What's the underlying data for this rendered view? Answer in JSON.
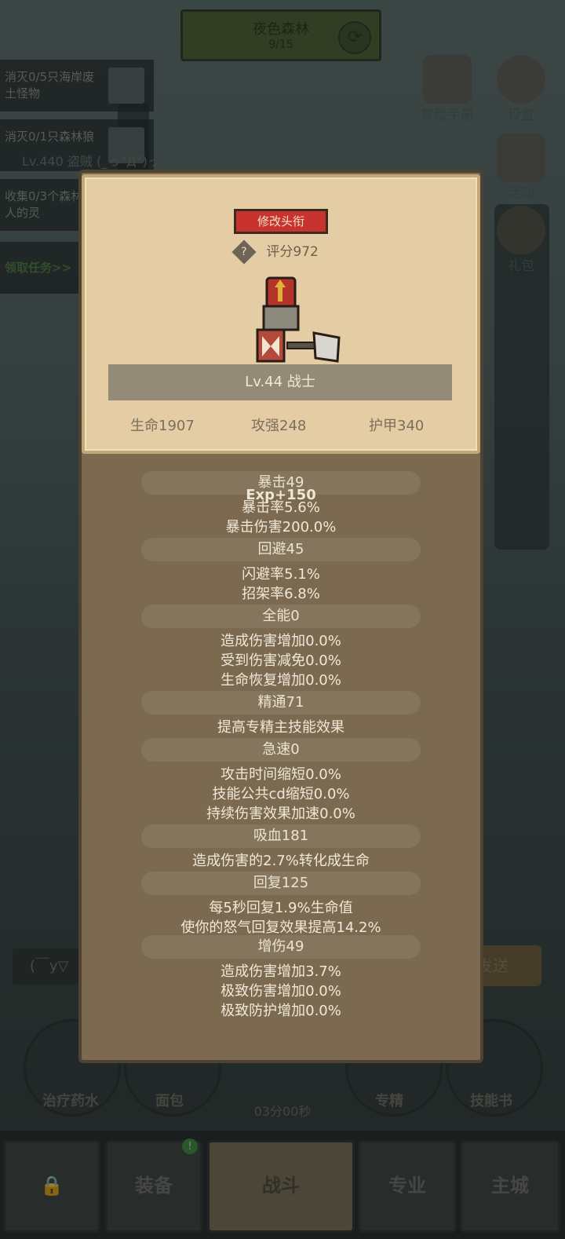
{
  "area": {
    "name": "夜色森林",
    "progress": "9/15"
  },
  "quests": [
    {
      "text": "消灭0/5只海岸废土怪物"
    },
    {
      "text": "消灭0/1只森林狼"
    },
    {
      "text": "收集0/3个森林巨人的灵"
    }
  ],
  "quest_link": "领取任务>>",
  "player_tag": "Lv.440 盗贼 (_っ°Д°)っ",
  "right_menu": [
    {
      "label": "冒险手册",
      "icon": "book-icon"
    },
    {
      "label": "设置",
      "icon": "gear-icon"
    },
    {
      "label": "活动",
      "icon": "calendar-icon"
    },
    {
      "label": "礼包",
      "icon": "gift-icon"
    }
  ],
  "character": {
    "rename_label": "修改头衔",
    "score": "评分972",
    "level_class": "Lv.44 战士",
    "hp": "生命1907",
    "attack": "攻强248",
    "armor": "护甲340"
  },
  "exp_popup": "Exp+150",
  "stats": [
    {
      "head": "暴击49",
      "lines": [
        "暴击率5.6%",
        "暴击伤害200.0%"
      ]
    },
    {
      "head": "回避45",
      "lines": [
        "闪避率5.1%",
        "招架率6.8%"
      ]
    },
    {
      "head": "全能0",
      "lines": [
        "造成伤害增加0.0%",
        "受到伤害减免0.0%",
        "生命恢复增加0.0%"
      ]
    },
    {
      "head": "精通71",
      "lines": [
        "提高专精主技能效果"
      ]
    },
    {
      "head": "急速0",
      "lines": [
        "攻击时间缩短0.0%",
        "技能公共cd缩短0.0%",
        "持续伤害效果加速0.0%"
      ]
    },
    {
      "head": "吸血181",
      "lines": [
        "造成伤害的2.7%转化成生命"
      ]
    },
    {
      "head": "回复125",
      "lines": [
        "每5秒回复1.9%生命值",
        "使你的怒气回复效果提高14.2%"
      ]
    },
    {
      "head": "增伤49",
      "lines": [
        "造成伤害增加3.7%",
        "极致伤害增加0.0%",
        "极致防护增加0.0%"
      ]
    }
  ],
  "chat": {
    "placeholder": "(￣y▽",
    "send_label": "发送"
  },
  "bottom_skills": [
    {
      "label": "治疗药水"
    },
    {
      "label": "面包"
    },
    {
      "label": "专精"
    },
    {
      "label": "技能书"
    }
  ],
  "timer": "03分00秒",
  "tabs": [
    {
      "label": "",
      "icon": "lock-icon"
    },
    {
      "label": "装备"
    },
    {
      "label": "战斗"
    },
    {
      "label": "专业"
    },
    {
      "label": "主城"
    }
  ],
  "notification": "!"
}
